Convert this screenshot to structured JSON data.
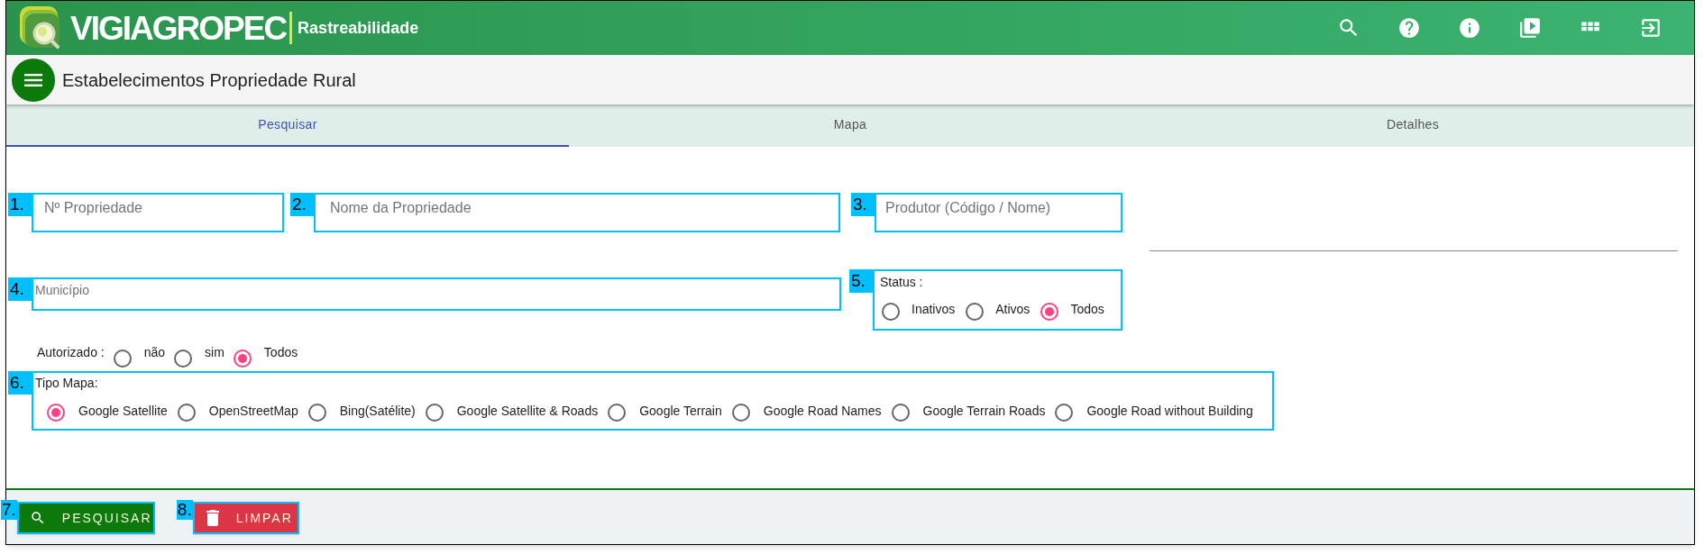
{
  "header": {
    "brand": "VIGIAGROPEC",
    "subtitle": "Rastreabilidade"
  },
  "page_title": "Estabelecimentos Propriedade Rural",
  "tabs": [
    {
      "label": "Pesquisar",
      "selected": true
    },
    {
      "label": "Mapa",
      "selected": false
    },
    {
      "label": "Detalhes",
      "selected": false
    }
  ],
  "fields": [
    {
      "number": "1.",
      "placeholder": "Nº Propriedade"
    },
    {
      "number": "2.",
      "placeholder": "Nome da Propriedade"
    },
    {
      "number": "3.",
      "placeholder": "Produtor (Código / Nome)"
    },
    {
      "number": "4.",
      "placeholder": "Município"
    }
  ],
  "status": {
    "number": "5.",
    "label": "Status :",
    "options": [
      {
        "label": "Inativos",
        "selected": false
      },
      {
        "label": "Ativos",
        "selected": false
      },
      {
        "label": "Todos",
        "selected": true
      }
    ]
  },
  "authorized": {
    "label": "Autorizado :",
    "options": [
      {
        "label": "não",
        "selected": false
      },
      {
        "label": "sim",
        "selected": false
      },
      {
        "label": "Todos",
        "selected": true
      }
    ]
  },
  "map_type": {
    "number": "6.",
    "label": "Tipo Mapa:",
    "options": [
      {
        "label": "Google Satellite",
        "selected": true
      },
      {
        "label": "OpenStreetMap",
        "selected": false
      },
      {
        "label": "Bing(Satélite)",
        "selected": false
      },
      {
        "label": "Google Satellite & Roads",
        "selected": false
      },
      {
        "label": "Google Terrain",
        "selected": false
      },
      {
        "label": "Google Road Names",
        "selected": false
      },
      {
        "label": "Google Terrain Roads",
        "selected": false
      },
      {
        "label": "Google Road without Building",
        "selected": false
      }
    ]
  },
  "buttons": [
    {
      "number": "7.",
      "label": "PESQUISAR",
      "kind": "search"
    },
    {
      "number": "8.",
      "label": "LIMPAR",
      "kind": "clear"
    }
  ]
}
